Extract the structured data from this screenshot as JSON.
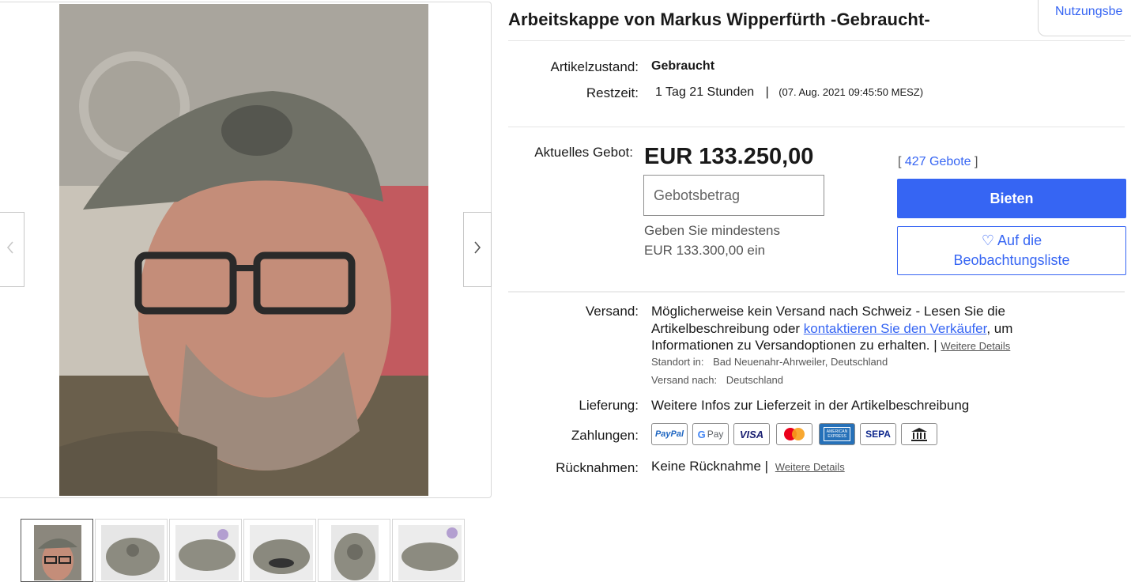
{
  "listing": {
    "title": "Arbeitskappe von Markus Wipperfürth -Gebraucht-"
  },
  "usage_tab": {
    "label": "Nutzungsbe"
  },
  "details": {
    "condition_label": "Artikelzustand:",
    "condition_value": "Gebraucht",
    "time_label": "Restzeit:",
    "time_value": "1 Tag 21 Stunden",
    "time_sep": "|",
    "time_end": "(07. Aug. 2021   09:45:50 MESZ)"
  },
  "bid": {
    "label": "Aktuelles Gebot:",
    "price": "EUR 133.250,00",
    "input_placeholder": "Gebotsbetrag",
    "hint_line1": "Geben Sie mindestens",
    "hint_line2": "EUR 133.300,00 ein",
    "bids_prefix": "[",
    "bids_count": "427 Gebote",
    "bids_suffix": "]",
    "bid_button": "Bieten",
    "watch_heart": "♡",
    "watch_line1": "Auf die",
    "watch_line2": "Beobachtungsliste"
  },
  "shipping": {
    "label": "Versand:",
    "text_part1": "Möglicherweise kein Versand nach Schweiz - Lesen Sie die Artikelbeschreibung oder",
    "contact_link": "kontaktieren Sie den Verkäufer",
    "text_part2": ", um Informationen zu Versandoptionen zu erhalten. |",
    "details_link": "Weitere Details",
    "location_label": "Standort in:",
    "location_value": "Bad Neuenahr-Ahrweiler, Deutschland",
    "shipto_label": "Versand nach:",
    "shipto_value": "Deutschland"
  },
  "delivery": {
    "label": "Lieferung:",
    "value": "Weitere Infos zur Lieferzeit in der Artikelbeschreibung"
  },
  "payments": {
    "label": "Zahlungen:",
    "methods": {
      "paypal": "PayPal",
      "gpay_g": "G",
      "gpay_pay": "Pay",
      "visa": "VISA",
      "amex": "AMERICAN EXPRESS",
      "sepa": "SEPA"
    }
  },
  "returns": {
    "label": "Rücknahmen:",
    "value": "Keine Rücknahme |",
    "details_link": "Weitere Details"
  },
  "colors": {
    "accent": "#3665f3",
    "text": "#191919",
    "muted": "#555555",
    "border": "#d8d8d8"
  },
  "icons": [
    "chevron-left-icon",
    "chevron-right-icon",
    "heart-icon",
    "bank-icon"
  ]
}
